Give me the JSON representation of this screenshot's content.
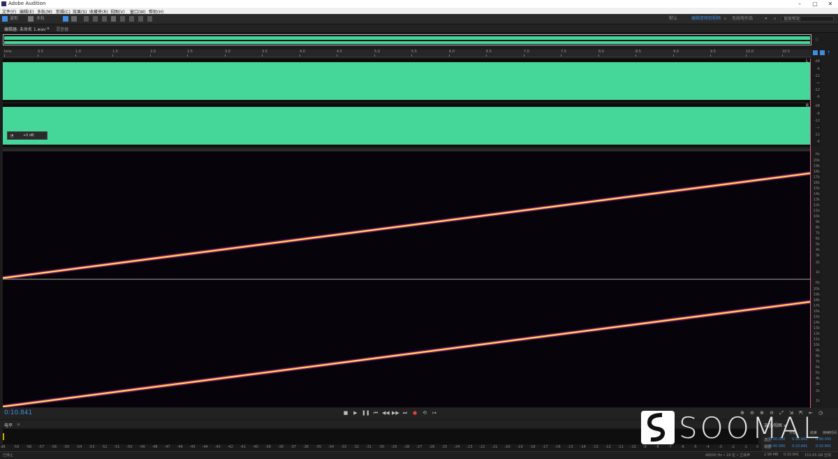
{
  "app": {
    "title": "Adobe Audition"
  },
  "window_controls": {
    "minimize": "–",
    "maximize": "▢",
    "close": "✕"
  },
  "menu": {
    "items": [
      "文件(F)",
      "编辑(E)",
      "多轨(M)",
      "剪辑(C)",
      "效果(S)",
      "收藏夹(R)",
      "视图(V)",
      "窗口(W)",
      "帮助(H)"
    ]
  },
  "toolbar": {
    "waveform_label": "波形",
    "multitrack_label": "多轨"
  },
  "workspaces": {
    "items": [
      "默认",
      "编辑音频到视频",
      "无线电作品"
    ],
    "active_index": 1,
    "more": "»"
  },
  "search": {
    "placeholder": "搜索帮助"
  },
  "editor": {
    "tab_label": "编辑器: 未命名 1.wav *",
    "mixer_label": "混音器"
  },
  "ruler": {
    "unit": "hms",
    "labels": [
      "0.5",
      "1.0",
      "1.5",
      "2.0",
      "2.5",
      "3.0",
      "3.5",
      "4.0",
      "4.5",
      "5.0",
      "5.5",
      "6.0",
      "6.5",
      "7.0",
      "7.5",
      "8.0",
      "8.5",
      "9.0",
      "9.5",
      "10.0",
      "10.5"
    ]
  },
  "waveform": {
    "channel_l_label": "L",
    "channel_r_label": "R",
    "db_scale": [
      "dB",
      "-6",
      "-12",
      "-∞",
      "-12",
      "-6"
    ],
    "hud_gain": "+0 dB",
    "color": "#45d69a"
  },
  "spectrogram": {
    "hz_label": "Hz",
    "freq_scale": [
      "20k",
      "19k",
      "18k",
      "17k",
      "16k",
      "15k",
      "14k",
      "13k",
      "12k",
      "11k",
      "10k",
      "9k",
      "8k",
      "7k",
      "6k",
      "5k",
      "4k",
      "3k",
      "2k",
      "1k"
    ]
  },
  "transport": {
    "timecode": "0:10.841"
  },
  "levels": {
    "panel_label": "电平",
    "scale": [
      "dB",
      "-59",
      "-58",
      "-57",
      "-56",
      "-55",
      "-54",
      "-53",
      "-52",
      "-51",
      "-50",
      "-49",
      "-48",
      "-47",
      "-46",
      "-45",
      "-44",
      "-43",
      "-42",
      "-41",
      "-40",
      "-39",
      "-38",
      "-37",
      "-36",
      "-35",
      "-34",
      "-33",
      "-32",
      "-31",
      "-30",
      "-29",
      "-28",
      "-27",
      "-26",
      "-25",
      "-24",
      "-23",
      "-22",
      "-21",
      "-20",
      "-19",
      "-18",
      "-17",
      "-16",
      "-15",
      "-14",
      "-13",
      "-12",
      "-11",
      "-10",
      "-9",
      "-8",
      "-7",
      "-6",
      "-5",
      "-4",
      "-3",
      "-2",
      "-1",
      "0"
    ]
  },
  "selection_panel": {
    "title": "选区/视图 ≡",
    "col_start": "开始",
    "col_end": "结束",
    "col_duration": "持续时间",
    "row_selection": "选区",
    "row_view": "视图",
    "sel_start": "0:00.000",
    "sel_end": "0:10.841",
    "sel_duration": "0:00.000",
    "view_start": "0:00.000",
    "view_end": "0:10.841",
    "view_duration": "0:10.841"
  },
  "status": {
    "left": "已停止",
    "sample": "48000 Hz • 24 位 • 立体声",
    "size": "2.98 MB",
    "duration": "0:10.841",
    "free": "153.65 GB 空闲"
  },
  "watermark": {
    "text": "SOOMAL"
  }
}
